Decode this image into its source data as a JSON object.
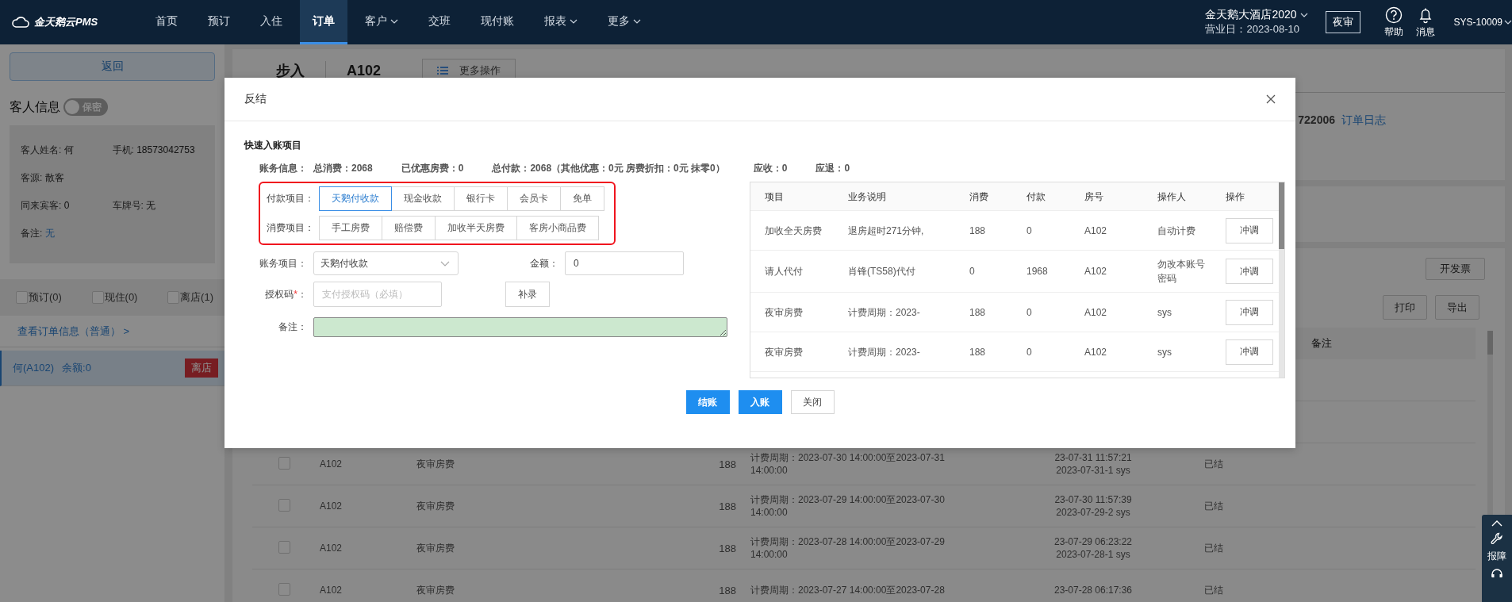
{
  "top_nav": {
    "logo": "金天鹅云PMS",
    "items": [
      {
        "label": "首页",
        "selected": false,
        "dropdown": false
      },
      {
        "label": "预订",
        "selected": false,
        "dropdown": false
      },
      {
        "label": "入住",
        "selected": false,
        "dropdown": false
      },
      {
        "label": "订单",
        "selected": true,
        "dropdown": false
      },
      {
        "label": "客户",
        "selected": false,
        "dropdown": true
      },
      {
        "label": "交班",
        "selected": false,
        "dropdown": false
      },
      {
        "label": "现付账",
        "selected": false,
        "dropdown": false
      },
      {
        "label": "报表",
        "selected": false,
        "dropdown": true
      },
      {
        "label": "更多",
        "selected": false,
        "dropdown": true
      }
    ],
    "hotel": "金天鹅大酒店2020",
    "business_date": "营业日：2023-08-10",
    "night_audit_button": "夜审",
    "help": "帮助",
    "messages": "消息",
    "user": "SYS-10009"
  },
  "sidebar": {
    "back_button": "返回",
    "guest_title": "客人信息",
    "privacy_toggle": {
      "label": "保密",
      "on": false
    },
    "guest_rows": [
      [
        {
          "label": "客人姓名:",
          "value": "何",
          "link": false
        },
        {
          "label": "手机:",
          "value": "18573042753",
          "link": false
        }
      ],
      [
        {
          "label": "客源:",
          "value": "散客",
          "link": false
        }
      ],
      [
        {
          "label": "同来宾客:",
          "value": "0",
          "link": false
        },
        {
          "label": "车牌号:",
          "value": "无",
          "link": false
        }
      ],
      [
        {
          "label": "备注:",
          "value": "无",
          "link": true
        }
      ]
    ],
    "filters": [
      {
        "label": "预订(0)",
        "checked": false
      },
      {
        "label": "现住(0)",
        "checked": false
      },
      {
        "label": "离店(1)",
        "checked": false
      }
    ],
    "order_link": "查看订单信息（普通） >",
    "orders": [
      {
        "name": "何(A102)",
        "balance": "余额:0",
        "status": "离店",
        "selected": true
      }
    ]
  },
  "order_header": {
    "status": "步入",
    "room": "A102",
    "more_button": "更多操作"
  },
  "order_info": {
    "order_no": "722006",
    "log_link": "订单日志"
  },
  "billing": {
    "invoice_button": "开发票",
    "buttons": [
      "打印",
      "导出"
    ],
    "remark_column": "备注",
    "rows": [
      {
        "checked": false,
        "room": "A102",
        "item": "夜审房费",
        "amount": "188",
        "period_lines": [
          "计费周期：2023-07-30 14:00:00至2023-07-31",
          "14:00:00"
        ],
        "time_lines": [
          "23-07-31 11:57:21",
          "2023-07-31-1 sys"
        ],
        "status": "已结"
      },
      {
        "checked": false,
        "room": "A102",
        "item": "夜审房费",
        "amount": "188",
        "period_lines": [
          "计费周期：2023-07-29 14:00:00至2023-07-30",
          "14:00:00"
        ],
        "time_lines": [
          "23-07-30 11:57:39",
          "2023-07-29-2 sys"
        ],
        "status": "已结"
      },
      {
        "checked": false,
        "room": "A102",
        "item": "夜审房费",
        "amount": "188",
        "period_lines": [
          "计费周期：2023-07-28 14:00:00至2023-07-29",
          "14:00:00"
        ],
        "time_lines": [
          "23-07-29 06:23:22",
          "2023-07-28-1 sys"
        ],
        "status": "已结"
      },
      {
        "checked": false,
        "room": "A102",
        "item": "夜审房费",
        "amount": "188",
        "period_lines": [
          "计费周期：2023-07-27 14:00:00至2023-07-28"
        ],
        "time_lines": [
          "23-07-28 06:17:36"
        ],
        "status": "已结"
      }
    ]
  },
  "modal": {
    "title": "反结",
    "section_title": "快速入账项目",
    "summary": [
      "账务信息：",
      "总消费：2068",
      "已优惠房费：0",
      "总付款：2068（其他优惠：0元 房费折扣：0元 抹零0）",
      "应收：0",
      "应退：0"
    ],
    "quick_groups": [
      {
        "label": "付款项目：",
        "options": [
          {
            "label": "天鹅付收款",
            "selected": true
          },
          {
            "label": "现金收款",
            "selected": false
          },
          {
            "label": "银行卡",
            "selected": false
          },
          {
            "label": "会员卡",
            "selected": false
          },
          {
            "label": "免单",
            "selected": false
          }
        ]
      },
      {
        "label": "消费项目：",
        "options": [
          {
            "label": "手工房费",
            "selected": false
          },
          {
            "label": "赔偿费",
            "selected": false
          },
          {
            "label": "加收半天房费",
            "selected": false
          },
          {
            "label": "客房小商品费",
            "selected": false
          }
        ]
      }
    ],
    "account_item": {
      "label": "账务项目：",
      "value": "天鹅付收款"
    },
    "amount": {
      "label": "金额：",
      "value": "0"
    },
    "auth_code": {
      "label": "授权码",
      "required_mark": "*",
      "suffix": "：",
      "placeholder": "支付授权码（必填）"
    },
    "supplement_button": "补录",
    "remark": {
      "label": "备注："
    },
    "table": {
      "columns": [
        "项目",
        "业务说明",
        "消费",
        "付款",
        "房号",
        "操作人",
        "操作"
      ],
      "rows": [
        {
          "item": "加收全天房费",
          "description": "退房超时271分钟,",
          "charge": "188",
          "payment": "0",
          "room": "A102",
          "operator": "自动计费",
          "action": "冲调"
        },
        {
          "item": "请人代付",
          "description": "肖锋(TS58)代付",
          "charge": "0",
          "payment": "1968",
          "room": "A102",
          "operator": "勿改本账号密码",
          "action": "冲调"
        },
        {
          "item": "夜审房费",
          "description": "计费周期：2023-",
          "charge": "188",
          "payment": "0",
          "room": "A102",
          "operator": "sys",
          "action": "冲调"
        },
        {
          "item": "夜审房费",
          "description": "计费周期：2023-",
          "charge": "188",
          "payment": "0",
          "room": "A102",
          "operator": "sys",
          "action": "冲调"
        }
      ]
    },
    "buttons": [
      {
        "label": "结账",
        "primary": true
      },
      {
        "label": "入账",
        "primary": true
      },
      {
        "label": "关闭",
        "primary": false
      }
    ]
  },
  "float_toolbar": {
    "label": "报障"
  }
}
